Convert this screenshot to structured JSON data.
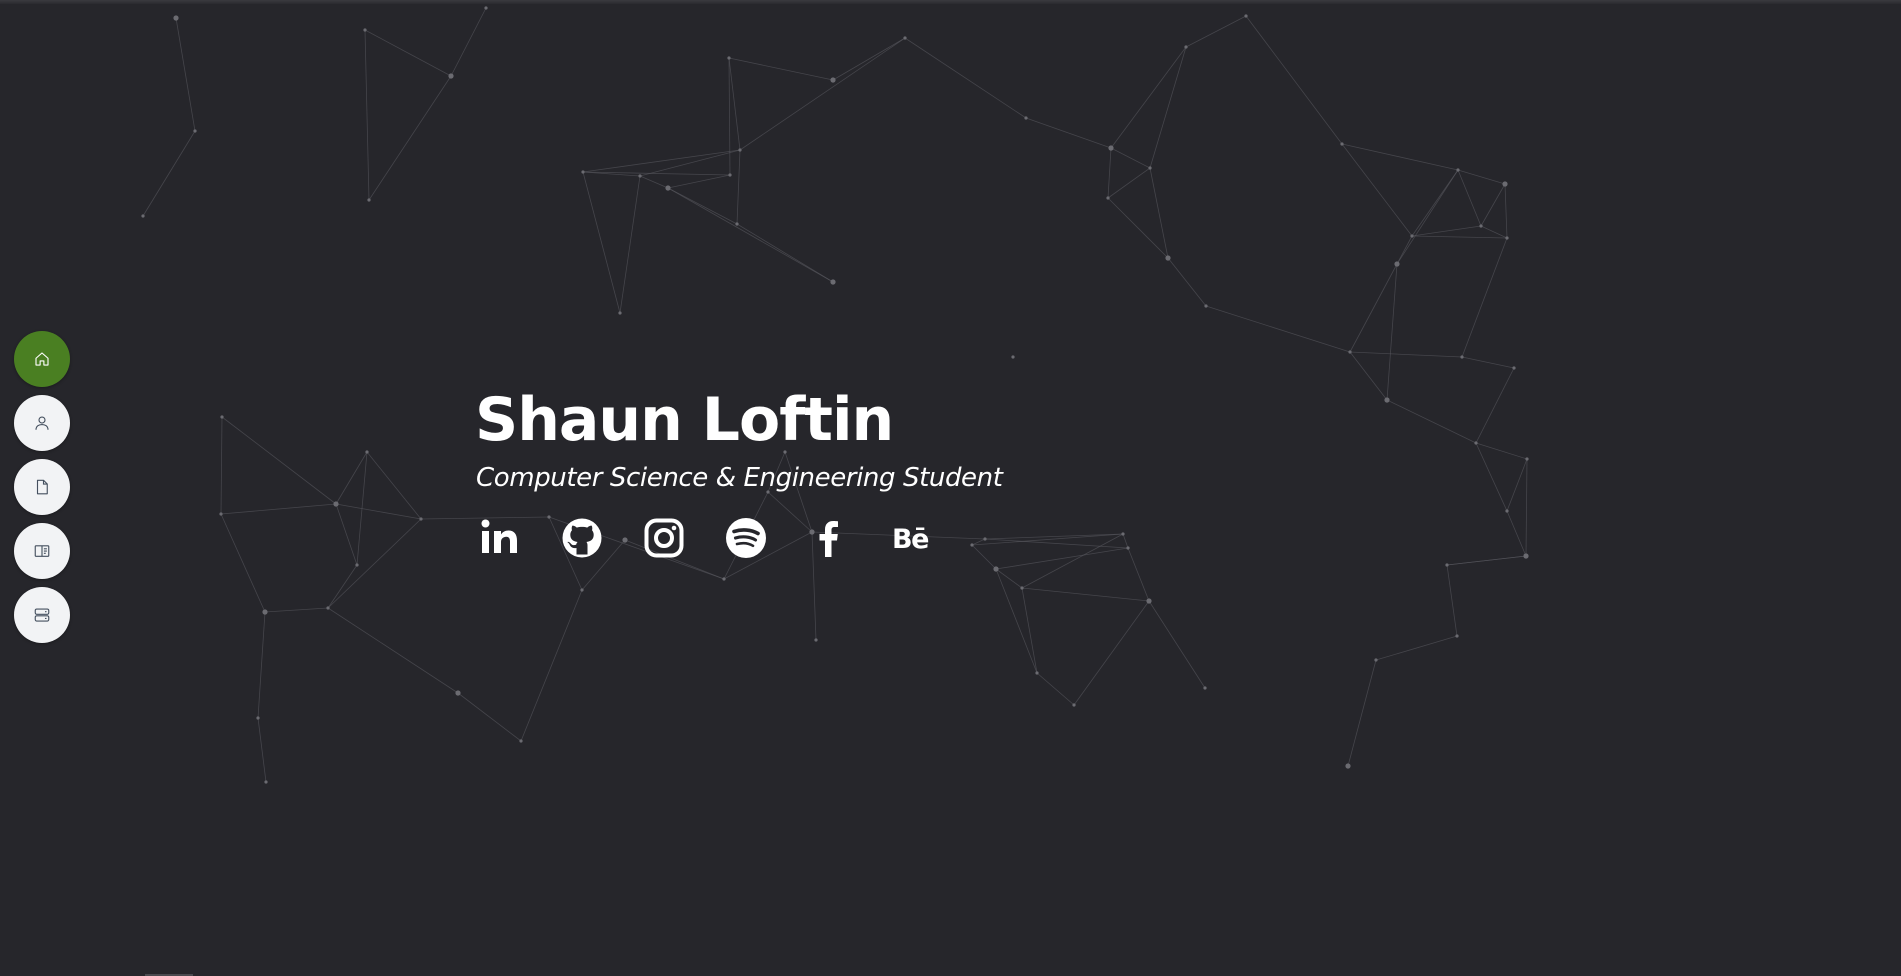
{
  "hero": {
    "name": "Shaun Loftin",
    "subtitle": "Computer Science & Engineering Student"
  },
  "nav": {
    "items": [
      {
        "icon": "home-icon",
        "active": true
      },
      {
        "icon": "user-icon",
        "active": false
      },
      {
        "icon": "document-icon",
        "active": false
      },
      {
        "icon": "book-open-icon",
        "active": false
      },
      {
        "icon": "server-icon",
        "active": false
      }
    ]
  },
  "socials": [
    {
      "icon": "linkedin-icon"
    },
    {
      "icon": "github-icon"
    },
    {
      "icon": "instagram-icon"
    },
    {
      "icon": "spotify-icon"
    },
    {
      "icon": "facebook-icon"
    },
    {
      "icon": "behance-icon",
      "text": "Bē"
    }
  ],
  "colors": {
    "background": "#26262b",
    "accent": "#4a7f22",
    "nav_button": "#f2f3f5",
    "text": "#ffffff",
    "network_line": "#5a5a60"
  }
}
